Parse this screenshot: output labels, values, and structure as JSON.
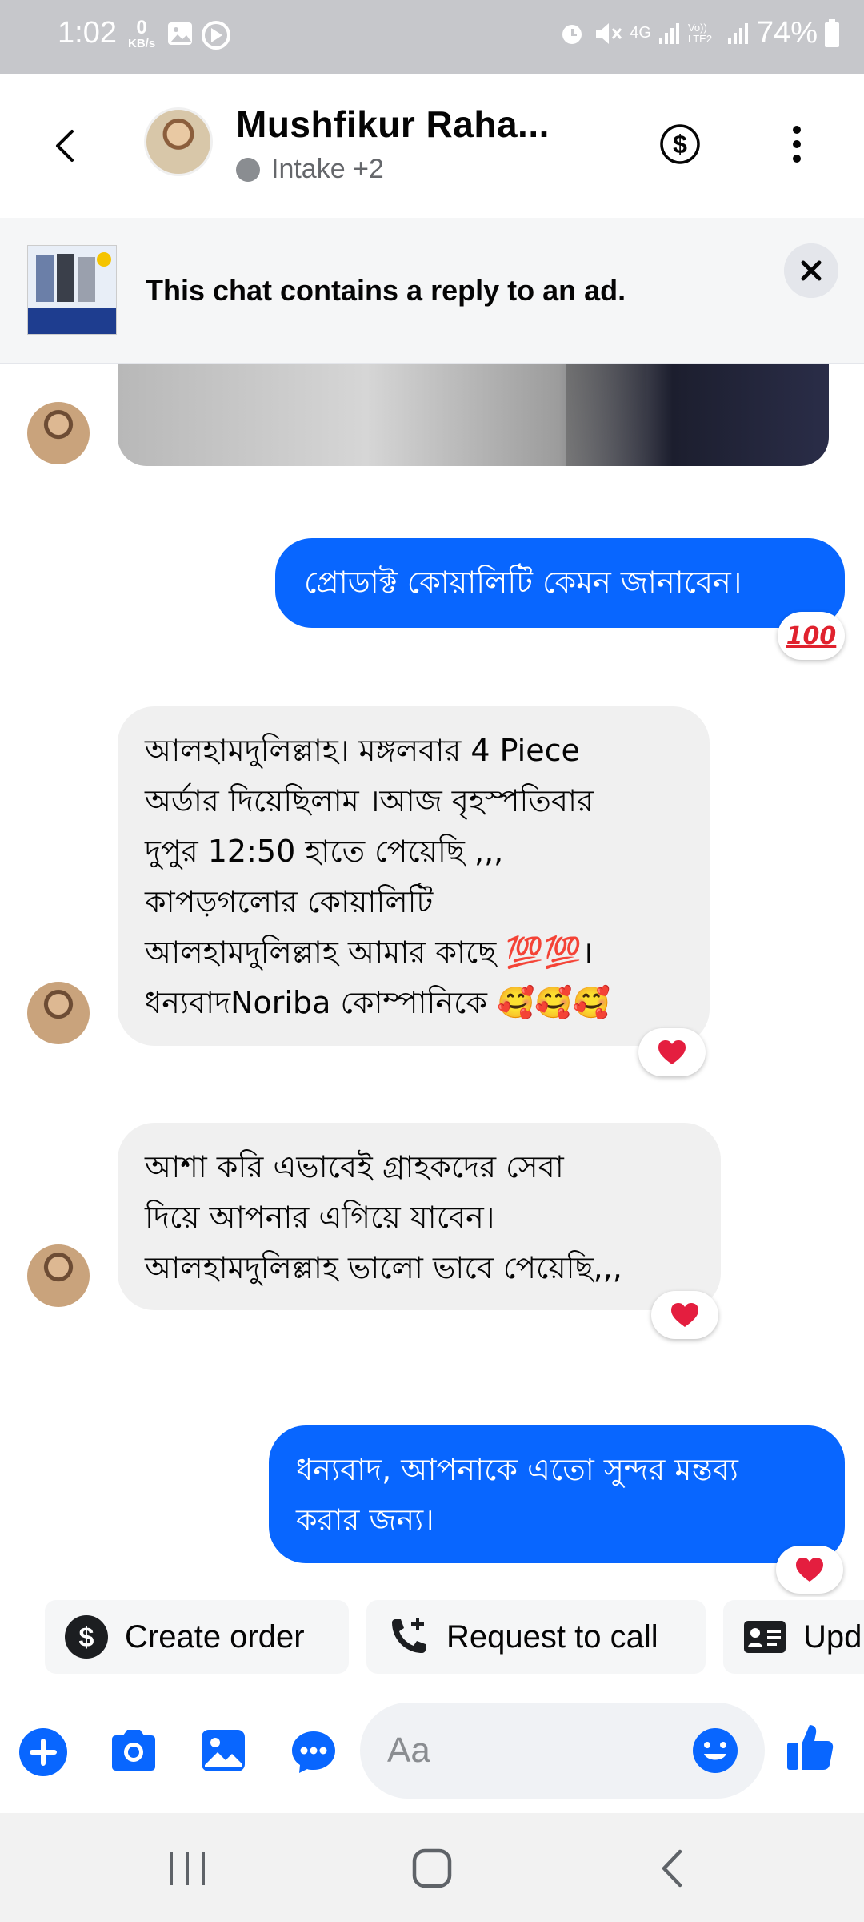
{
  "status_bar": {
    "time": "1:02",
    "net_speed_value": "0",
    "net_speed_unit": "KB/s",
    "network_4g": "4G",
    "volte_label": "Vo)) LTE2",
    "battery": "74%"
  },
  "header": {
    "contact_name": "Mushfikur Raha...",
    "subtitle": "Intake +2"
  },
  "ad_banner": {
    "text": "This chat contains a reply to an ad."
  },
  "messages": [
    {
      "direction": "outgoing",
      "lines": [
        "প্রোডাক্ট কোয়ালিটি কেমন জানাবেন।"
      ],
      "reaction": "💯"
    },
    {
      "direction": "incoming",
      "lines": [
        "আলহামদুলিল্লাহ। মঙ্গলবার 4 Piece",
        "অর্ডার দিয়েছিলাম ।আজ বৃহস্পতিবার",
        "দুপুর 12:50 হাতে পেয়েছি ,,,",
        "কাপড়গলোর কোয়ালিটি",
        "আলহামদুলিল্লাহ আমার কাছে 💯💯।",
        "ধন্যবাদNoriba কোম্পানিকে 🥰🥰🥰"
      ],
      "reaction": "❤️"
    },
    {
      "direction": "incoming",
      "lines": [
        "আশা করি এভাবেই গ্রাহকদের সেবা",
        "দিয়ে আপনার এগিয়ে যাবেন।",
        "আলহামদুলিল্লাহ ভালো ভাবে পেয়েছি,,,"
      ],
      "reaction": "❤️"
    },
    {
      "direction": "outgoing",
      "lines": [
        "ধন্যবাদ, আপনাকে এতো সুন্দর মন্তব্য",
        "করার জন্য।"
      ],
      "reaction": "❤️"
    }
  ],
  "quick_actions": [
    {
      "label": "Create order",
      "icon": "dollar-circle-icon"
    },
    {
      "label": "Request to call",
      "icon": "phone-add-icon"
    },
    {
      "label": "Upd",
      "icon": "contact-card-icon"
    }
  ],
  "composer": {
    "placeholder": "Aa"
  },
  "colors": {
    "messenger_blue": "#0866ff",
    "incoming_bubble": "#f0f0f0",
    "status_bar": "#c6c7cb"
  }
}
